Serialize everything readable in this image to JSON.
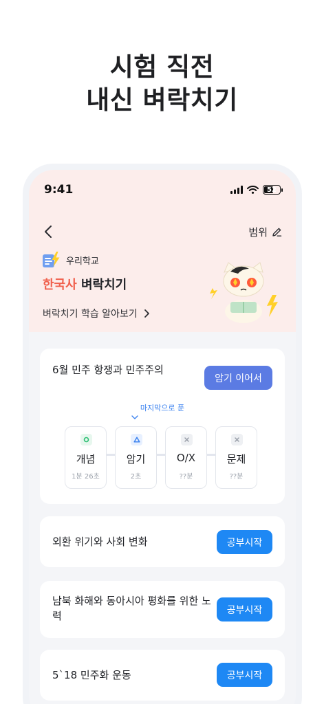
{
  "headline": {
    "line1": "시험 직전",
    "line2": "내신 벼락치기"
  },
  "status": {
    "time": "9:41",
    "battery": "52"
  },
  "header": {
    "range_label": "범위"
  },
  "school": {
    "name": "우리학교"
  },
  "subject": {
    "name": "한국사",
    "suffix": " 벼락치기"
  },
  "learn_link": "벼락치기 학습 알아보기",
  "current_unit": {
    "title": "6월 민주 항쟁과 민주주의",
    "continue_label": "암기 이어서",
    "last_solved_label": "마지막으로 푼",
    "steps": [
      {
        "name": "개념",
        "time": "1분 26초",
        "state": "done",
        "icon": "circle-icon"
      },
      {
        "name": "암기",
        "time": "2초",
        "state": "last",
        "icon": "triangle-icon"
      },
      {
        "name": "O/X",
        "time": "??분",
        "state": "todo",
        "icon": "x-icon"
      },
      {
        "name": "문제",
        "time": "??분",
        "state": "todo",
        "icon": "x-icon"
      }
    ]
  },
  "units": [
    {
      "title": "외환 위기와 사회 변화",
      "button": "공부시작"
    },
    {
      "title": "남북 화해와 동아시아 평화를 위한 노력",
      "button": "공부시작"
    },
    {
      "title": "5`18 민주화 운동",
      "button": "공부시작"
    }
  ],
  "colors": {
    "accent": "#f0614e",
    "continue": "#5b7be3",
    "start": "#1e88f4",
    "hero_bg": "#fcedeb"
  }
}
